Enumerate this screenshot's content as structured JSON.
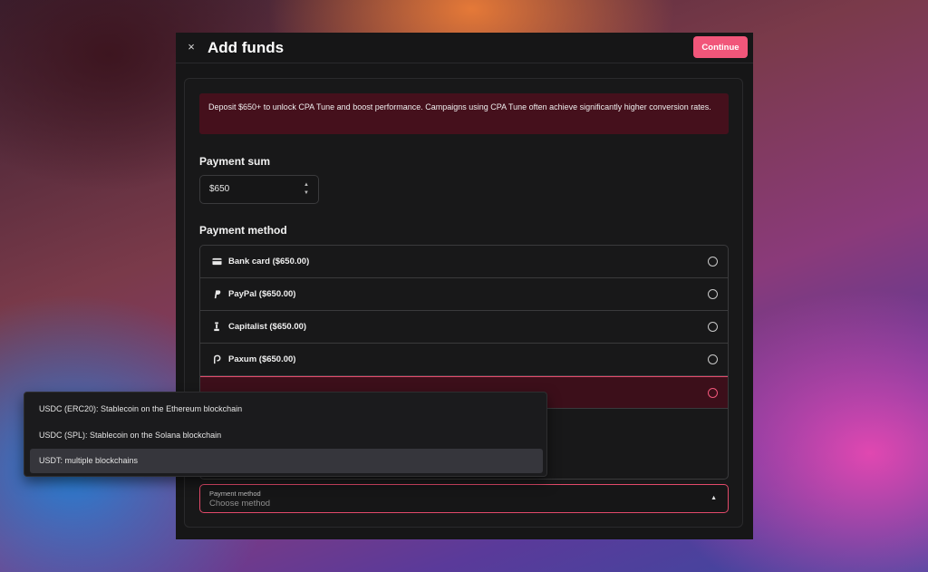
{
  "header": {
    "close_icon": "×",
    "title": "Add funds",
    "continue_label": "Continue"
  },
  "alert": {
    "text": "Deposit $650+ to unlock CPA Tune and boost performance. Campaigns using CPA Tune often achieve significantly higher conversion rates."
  },
  "payment_sum": {
    "label": "Payment sum",
    "value": "$650",
    "stepper_up": "▲",
    "stepper_down": "▼"
  },
  "payment_method": {
    "label": "Payment method",
    "options": [
      {
        "icon": "credit-card-icon",
        "label": "Bank card ($650.00)",
        "selected": false
      },
      {
        "icon": "paypal-icon",
        "label": "PayPal ($650.00)",
        "selected": false
      },
      {
        "icon": "capitalist-icon",
        "label": "Capitalist ($650.00)",
        "selected": false
      },
      {
        "icon": "paxum-icon",
        "label": "Paxum ($650.00)",
        "selected": false
      },
      {
        "icon": "crypto-icon",
        "label": "",
        "selected": true
      }
    ]
  },
  "dropdown": {
    "options": [
      {
        "label": "USDC (ERC20): Stablecoin on the Ethereum blockchain",
        "highlighted": false
      },
      {
        "label": "USDC (SPL): Stablecoin on the Solana blockchain",
        "highlighted": false
      },
      {
        "label": "USDT: multiple blockchains",
        "highlighted": true
      }
    ]
  },
  "method_select": {
    "label": "Payment method",
    "placeholder": "Choose method",
    "caret": "▲"
  },
  "colors": {
    "accent": "#f1567a",
    "alert_bg": "#45101c",
    "panel": "#161617",
    "option_highlight": "#36363c"
  }
}
